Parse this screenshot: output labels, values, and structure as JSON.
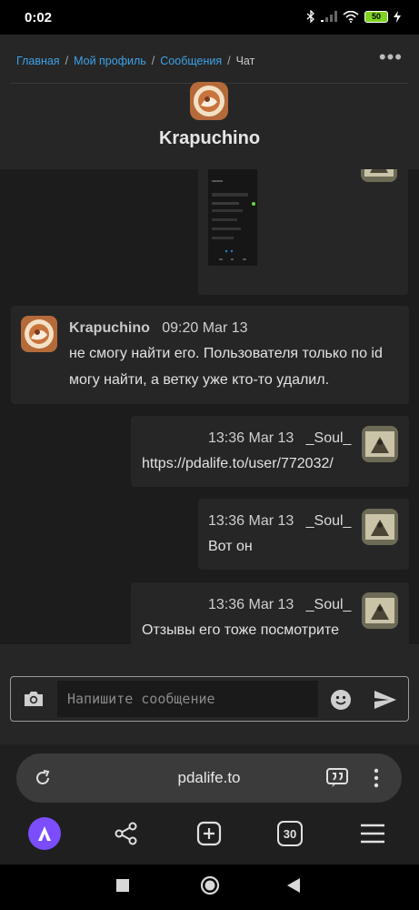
{
  "status_bar": {
    "time": "0:02",
    "battery": "50",
    "icons": [
      "bluetooth-icon",
      "signal-icon",
      "wifi-icon",
      "battery-icon",
      "charging-icon"
    ]
  },
  "header": {
    "breadcrumb": [
      "Главная",
      "Мой профиль",
      "Сообщения",
      "Чат"
    ],
    "separator": "/",
    "title": "Krapuchino",
    "more_label": "•••"
  },
  "messages": [
    {
      "author": "Krapuchino",
      "time": "09:20 Mar 13",
      "lines": [
        "не смогу найти его. Пользователя только по id",
        "могу найти, а ветку уже кто-то удалил."
      ]
    },
    {
      "author": "_Soul_",
      "time": "13:36 Mar 13",
      "lines": [
        "https://pdalife.to/user/772032/"
      ]
    },
    {
      "author": "_Soul_",
      "time": "13:36 Mar 13",
      "lines": [
        "Вот он"
      ]
    },
    {
      "author": "_Soul_",
      "time": "13:36 Mar 13",
      "lines": [
        "Отзывы его тоже посмотрите"
      ]
    }
  ],
  "composer": {
    "placeholder": "Напишите сообщение"
  },
  "browser": {
    "url": "pdalife.to",
    "tabs_count": "30"
  },
  "colors": {
    "link": "#3ea3e8",
    "background": "#1c1c1c",
    "bubble": "#262626",
    "alice": "#7b4dff"
  }
}
